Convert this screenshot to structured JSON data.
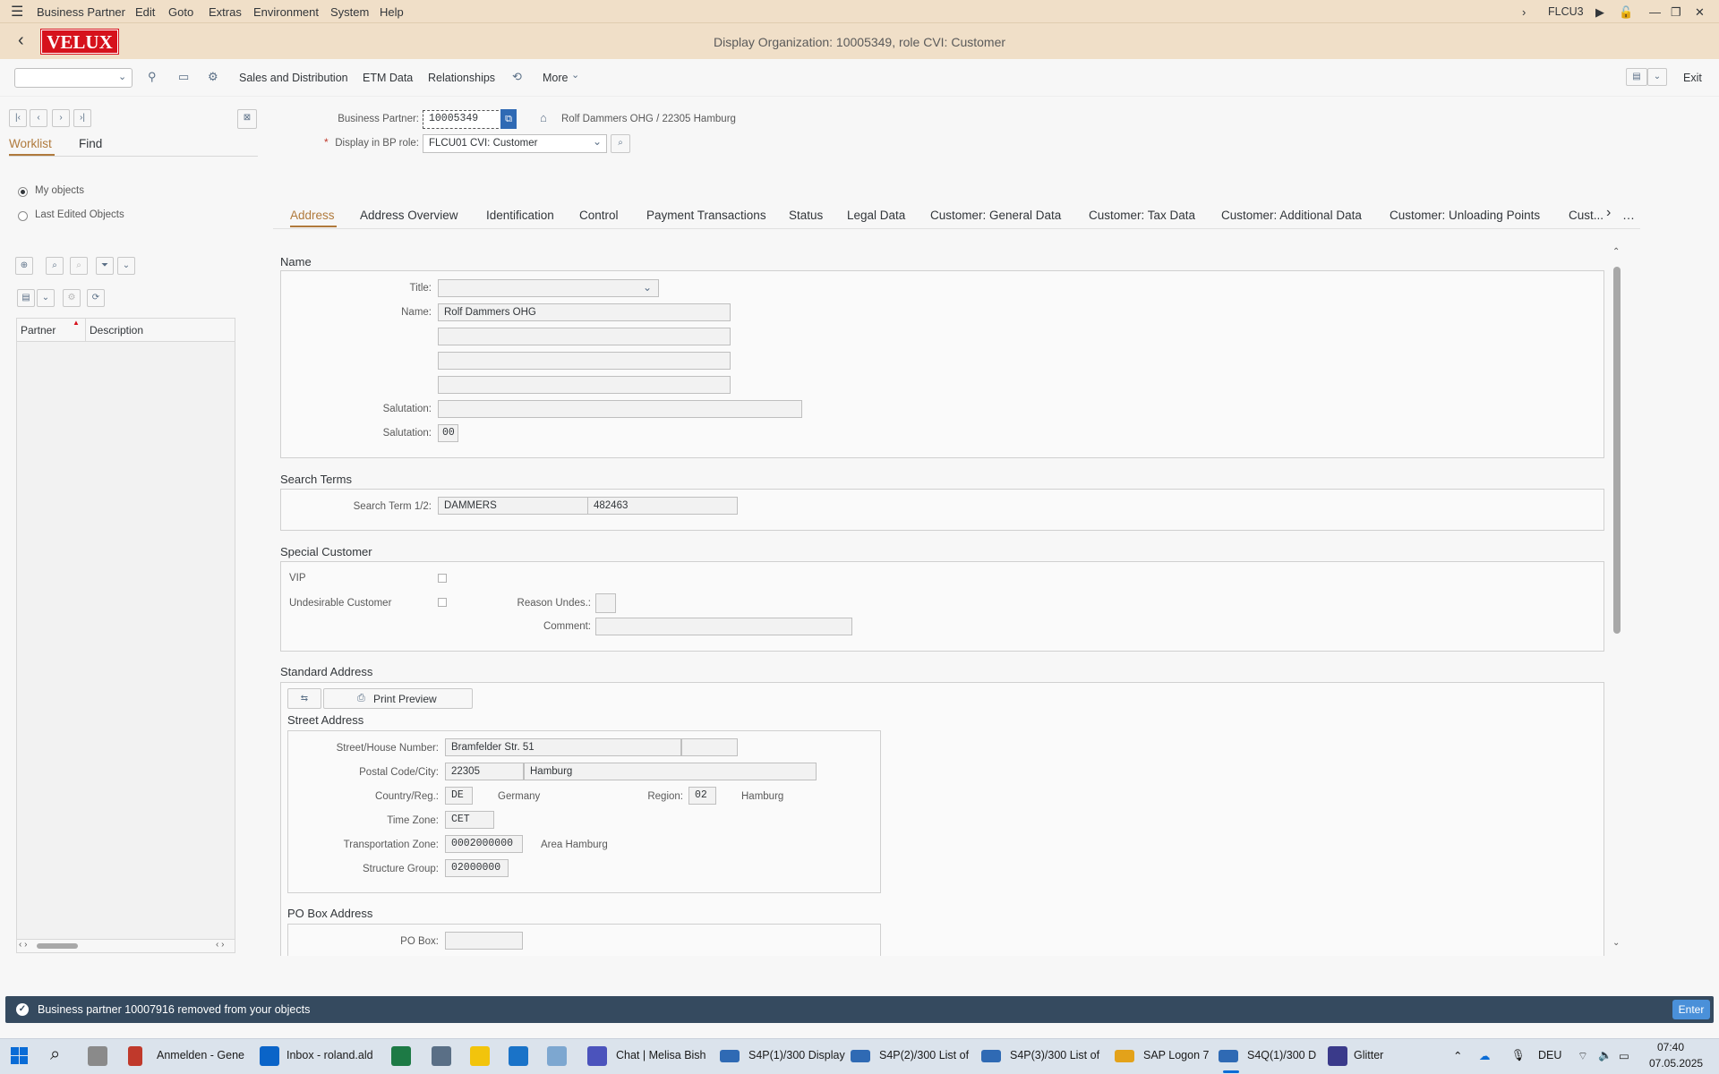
{
  "menu": {
    "items": [
      "Business Partner",
      "Edit",
      "Goto",
      "Extras",
      "Environment",
      "System",
      "Help"
    ],
    "system_id": "FLCU3"
  },
  "header": {
    "logo_text": "VELUX",
    "title": "Display Organization: 10005349, role CVI: Customer"
  },
  "toolbar": {
    "sales_distribution": "Sales and Distribution",
    "etm_data": "ETM Data",
    "relationships": "Relationships",
    "more": "More",
    "exit": "Exit"
  },
  "left_panel": {
    "tabs": [
      "Worklist",
      "Find"
    ],
    "radio_my_objects": "My objects",
    "radio_last_edited": "Last Edited Objects",
    "col_partner": "Partner",
    "col_description": "Description"
  },
  "bp_header": {
    "bp_label": "Business Partner:",
    "bp_value": "10005349",
    "bp_desc": "Rolf Dammers OHG / 22305 Hamburg",
    "role_label": "Display in BP role:",
    "role_value": "FLCU01 CVI: Customer"
  },
  "tabs": [
    "Address",
    "Address Overview",
    "Identification",
    "Control",
    "Payment Transactions",
    "Status",
    "Legal Data",
    "Customer: General Data",
    "Customer: Tax Data",
    "Customer: Additional Data",
    "Customer: Unloading Points",
    "Cust..."
  ],
  "name_section": {
    "heading": "Name",
    "title_label": "Title:",
    "name_label": "Name:",
    "name_value": "Rolf Dammers OHG",
    "salutation_label": "Salutation:",
    "salutation2_label": "Salutation:",
    "salutation2_value": "00"
  },
  "search_terms": {
    "heading": "Search Terms",
    "label": "Search Term 1/2:",
    "term1": "DAMMERS",
    "term2": "482463"
  },
  "special_customer": {
    "heading": "Special Customer",
    "vip": "VIP",
    "undesirable": "Undesirable Customer",
    "reason": "Reason Undes.:",
    "comment": "Comment:"
  },
  "standard_address": {
    "heading": "Standard Address",
    "print_preview": "Print Preview",
    "street_heading": "Street Address",
    "street_label": "Street/House Number:",
    "street_value": "Bramfelder Str. 51",
    "postal_label": "Postal Code/City:",
    "postal_value": "22305",
    "city_value": "Hamburg",
    "country_label": "Country/Reg.:",
    "country_value": "DE",
    "country_name": "Germany",
    "region_label": "Region:",
    "region_value": "02",
    "region_name": "Hamburg",
    "tz_label": "Time Zone:",
    "tz_value": "CET",
    "transzone_label": "Transportation Zone:",
    "transzone_value": "0002000000",
    "transzone_name": "Area Hamburg",
    "structure_label": "Structure Group:",
    "structure_value": "02000000",
    "pobox_heading": "PO Box Address",
    "pobox_label": "PO Box:"
  },
  "status_bar": {
    "message": "Business partner 10007916 removed from your objects",
    "enter": "Enter"
  },
  "taskbar": {
    "apps": [
      "Anmelden - Gene",
      "Inbox - roland.ald",
      "Chat | Melisa Bish",
      "S4P(1)/300 Display",
      "S4P(2)/300 List of",
      "S4P(3)/300 List of",
      "SAP Logon 7",
      "S4Q(1)/300 D",
      "Glitter"
    ],
    "lang": "DEU",
    "time": "07:40",
    "date": "07.05.2025"
  },
  "colors": {
    "header_bg": "#f0dfc8",
    "brand_red": "#d6121c",
    "active_tab": "#b07a3c",
    "status_bar": "#354a5f",
    "enter_btn": "#4a90d9"
  }
}
